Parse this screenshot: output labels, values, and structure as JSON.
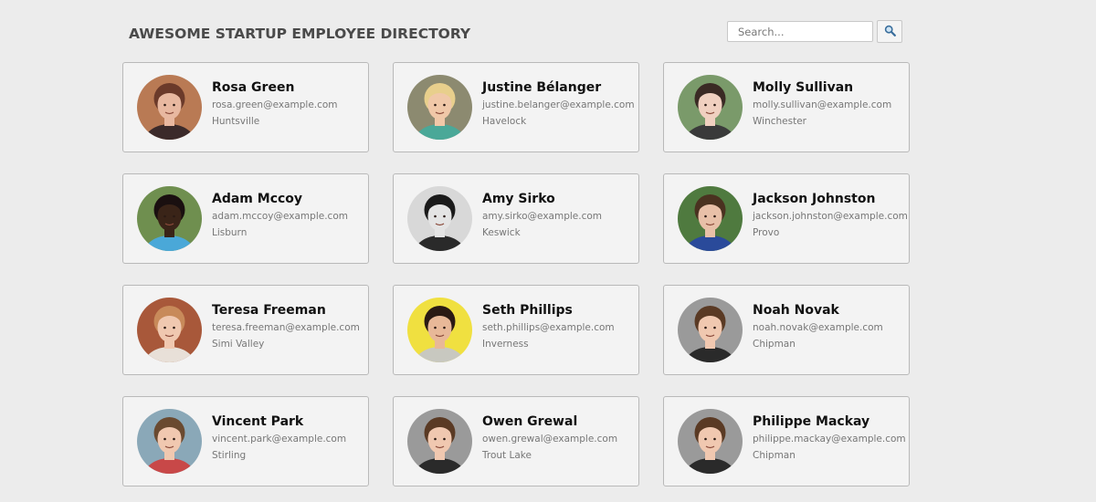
{
  "header": {
    "title": "AWESOME STARTUP EMPLOYEE DIRECTORY"
  },
  "search": {
    "placeholder": "Search...",
    "value": "",
    "button_icon": "magnifier-icon"
  },
  "employees": [
    {
      "name": "Rosa Green",
      "email": "rosa.green@example.com",
      "city": "Huntsville",
      "bg": "#b97a54",
      "skin": "#e8b8a0",
      "hair": "#6b3a2a",
      "shirt": "#3b2a2a"
    },
    {
      "name": "Justine Bélanger",
      "email": "justine.belanger@example.com",
      "city": "Havelock",
      "bg": "#8c8a70",
      "skin": "#f0c8a8",
      "hair": "#e8cf8c",
      "shirt": "#4aa898"
    },
    {
      "name": "Molly Sullivan",
      "email": "molly.sullivan@example.com",
      "city": "Winchester",
      "bg": "#7a9a6a",
      "skin": "#f0d0c0",
      "hair": "#3a2a24",
      "shirt": "#3a3a3a"
    },
    {
      "name": "Adam Mccoy",
      "email": "adam.mccoy@example.com",
      "city": "Lisburn",
      "bg": "#6f8f4f",
      "skin": "#3a2418",
      "hair": "#1a1010",
      "shirt": "#4aa8d8"
    },
    {
      "name": "Amy Sirko",
      "email": "amy.sirko@example.com",
      "city": "Keswick",
      "bg": "#d8d8d8",
      "skin": "#e4e4e4",
      "hair": "#1a1a1a",
      "shirt": "#2a2a2a"
    },
    {
      "name": "Jackson Johnston",
      "email": "jackson.johnston@example.com",
      "city": "Provo",
      "bg": "#4f7a3f",
      "skin": "#e8c0a8",
      "hair": "#4a3220",
      "shirt": "#2a4a9a"
    },
    {
      "name": "Teresa Freeman",
      "email": "teresa.freeman@example.com",
      "city": "Simi Valley",
      "bg": "#a8583a",
      "skin": "#f0c8b0",
      "hair": "#c88a5a",
      "shirt": "#e8e0d8"
    },
    {
      "name": "Seth Phillips",
      "email": "seth.phillips@example.com",
      "city": "Inverness",
      "bg": "#f0e040",
      "skin": "#e8b898",
      "hair": "#2a1a14",
      "shirt": "#c8c8c0"
    },
    {
      "name": "Noah Novak",
      "email": "noah.novak@example.com",
      "city": "Chipman",
      "bg": "#9a9a9a",
      "skin": "#f0c8b0",
      "hair": "#5a3a24",
      "shirt": "#2a2a2a"
    },
    {
      "name": "Vincent Park",
      "email": "vincent.park@example.com",
      "city": "Stirling",
      "bg": "#8aa8b8",
      "skin": "#f0c8b0",
      "hair": "#6a4a30",
      "shirt": "#c84848"
    },
    {
      "name": "Owen Grewal",
      "email": "owen.grewal@example.com",
      "city": "Trout Lake",
      "bg": "#9a9a9a",
      "skin": "#f0c8b0",
      "hair": "#5a3a24",
      "shirt": "#2a2a2a"
    },
    {
      "name": "Philippe Mackay",
      "email": "philippe.mackay@example.com",
      "city": "Chipman",
      "bg": "#9a9a9a",
      "skin": "#f0c8b0",
      "hair": "#5a3a24",
      "shirt": "#2a2a2a"
    }
  ]
}
